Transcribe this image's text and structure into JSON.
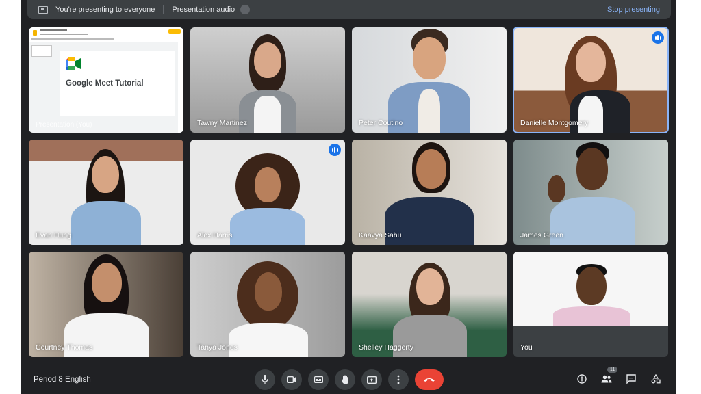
{
  "presenting_bar": {
    "status_text": "You're presenting to everyone",
    "audio_label": "Presentation audio",
    "audio_on": false,
    "stop_label": "Stop presenting"
  },
  "presentation_tile": {
    "slide_title": "Google Meet Tutorial",
    "name_label": "Presentation (You)"
  },
  "participants": [
    {
      "name": "Tawny Martinez",
      "speaking": false
    },
    {
      "name": "Peter Coutino",
      "speaking": false
    },
    {
      "name": "Danielle Montgomery",
      "speaking": true
    },
    {
      "name": "Evan Hung",
      "speaking": false
    },
    {
      "name": "Alex Harris",
      "speaking": true
    },
    {
      "name": "Kaavya Sahu",
      "speaking": false
    },
    {
      "name": "James Green",
      "speaking": false
    },
    {
      "name": "Courtney Thomas",
      "speaking": false
    },
    {
      "name": "Tanya Jones",
      "speaking": false
    },
    {
      "name": "Shelley Haggerty",
      "speaking": false
    },
    {
      "name": "You",
      "speaking": false
    }
  ],
  "bottom_bar": {
    "meeting_name": "Period 8 English",
    "controls": [
      "microphone",
      "camera",
      "captions",
      "raise-hand",
      "present",
      "more-options",
      "leave-call"
    ],
    "participant_count": "11"
  },
  "colors": {
    "background": "#202124",
    "surface": "#3c4043",
    "accent": "#8ab4f8",
    "speaking": "#1a73e8",
    "end_call": "#ea4335"
  }
}
